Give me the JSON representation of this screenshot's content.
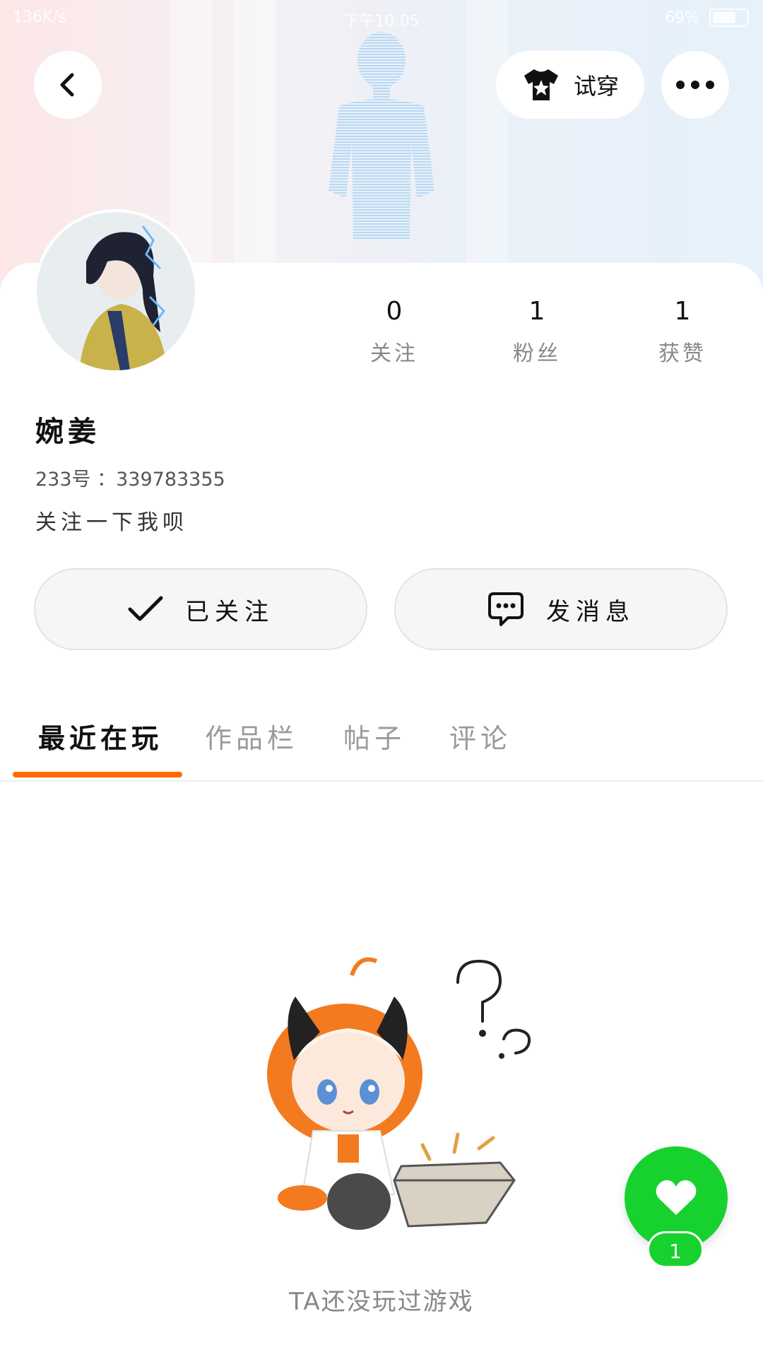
{
  "status_bar": {
    "speed": "136K/s",
    "time": "下午10:05",
    "battery": "69%"
  },
  "header": {
    "tryon_label": "试穿"
  },
  "profile": {
    "name": "婉姜",
    "id_text": "233号 ：339783355",
    "bio": "关注一下我呗"
  },
  "stats": [
    {
      "value": "0",
      "label": "关注"
    },
    {
      "value": "1",
      "label": "粉丝"
    },
    {
      "value": "1",
      "label": "获赞"
    }
  ],
  "actions": {
    "follow_label": "已关注",
    "message_label": "发消息"
  },
  "tabs": [
    {
      "label": "最近在玩",
      "active": true
    },
    {
      "label": "作品栏",
      "active": false
    },
    {
      "label": "帖子",
      "active": false
    },
    {
      "label": "评论",
      "active": false
    }
  ],
  "empty_state": {
    "text": "TA还没玩过游戏"
  },
  "like": {
    "count": "1"
  },
  "colors": {
    "accent": "#ff6a00",
    "like_green": "#17d22e"
  }
}
